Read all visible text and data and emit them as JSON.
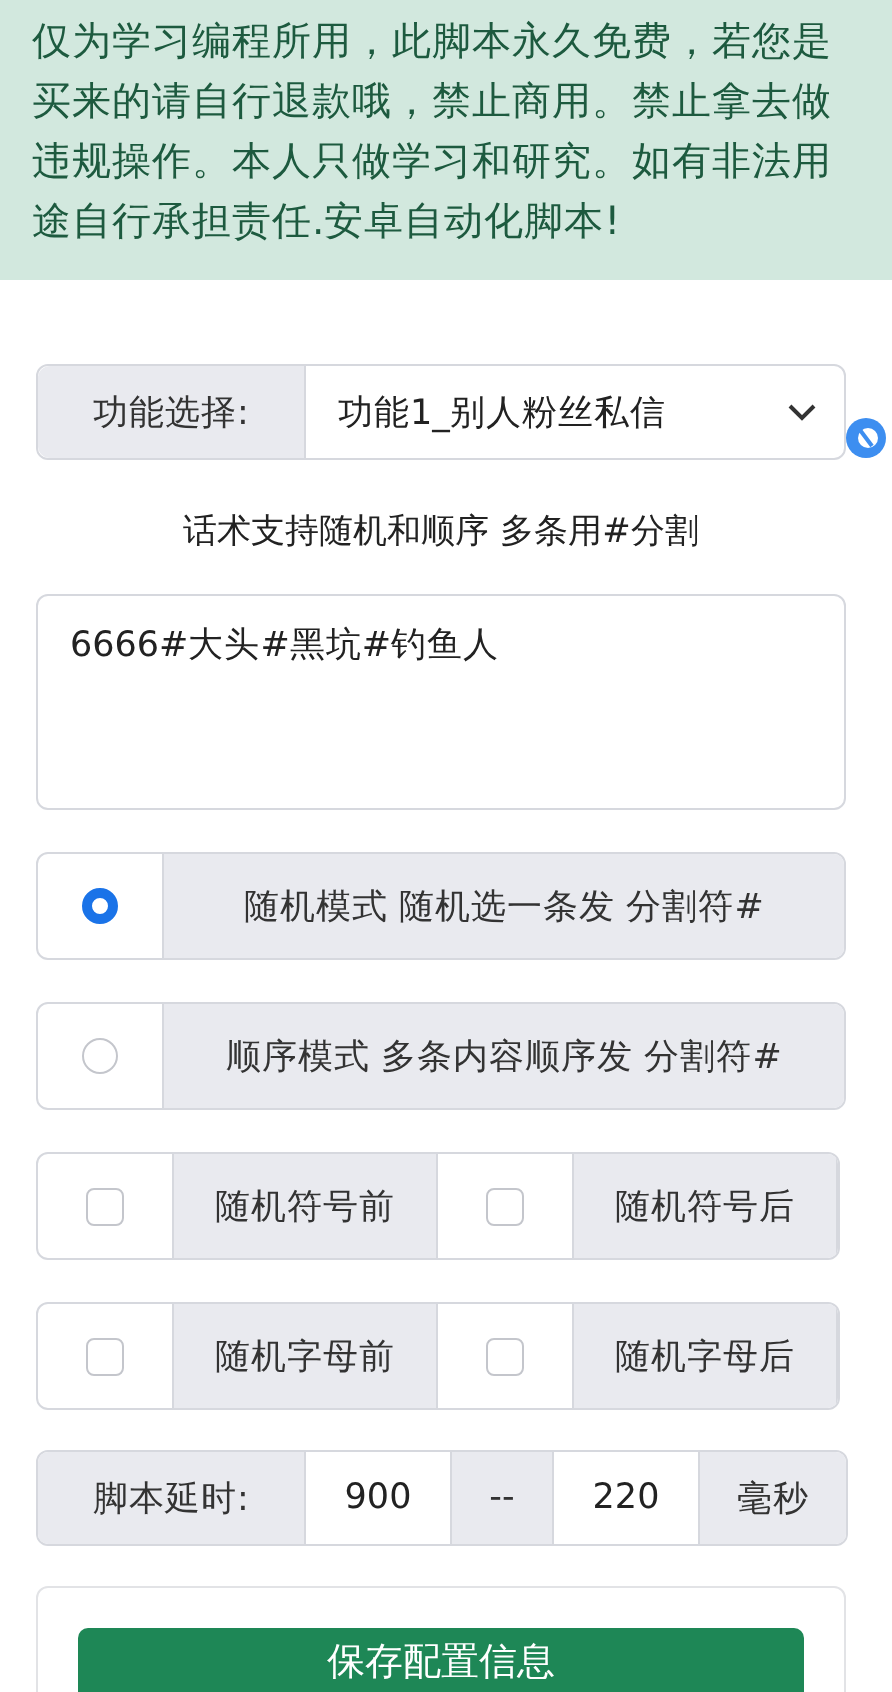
{
  "notice": "仅为学习编程所用，此脚本永久免费，若您是买来的请自行退款哦，禁止商用。禁止拿去做违规操作。本人只做学习和研究。如有非法用途自行承担责任.安卓自动化脚本!",
  "function_select": {
    "label": "功能选择:",
    "value": "功能1_别人粉丝私信"
  },
  "hint": "话术支持随机和顺序 多条用#分割",
  "message_field": {
    "value": "6666#大头#黑坑#钓鱼人"
  },
  "modes": [
    {
      "label": "随机模式 随机选一条发 分割符#",
      "selected": true
    },
    {
      "label": "顺序模式 多条内容顺序发 分割符#",
      "selected": false
    }
  ],
  "options": [
    {
      "label": "随机符号前",
      "checked": false
    },
    {
      "label": "随机符号后",
      "checked": false
    },
    {
      "label": "随机字母前",
      "checked": false
    },
    {
      "label": "随机字母后",
      "checked": false
    }
  ],
  "delay": {
    "label": "脚本延时:",
    "min": "900",
    "separator": "--",
    "max": "220",
    "unit": "毫秒"
  },
  "save_button": "保存配置信息"
}
